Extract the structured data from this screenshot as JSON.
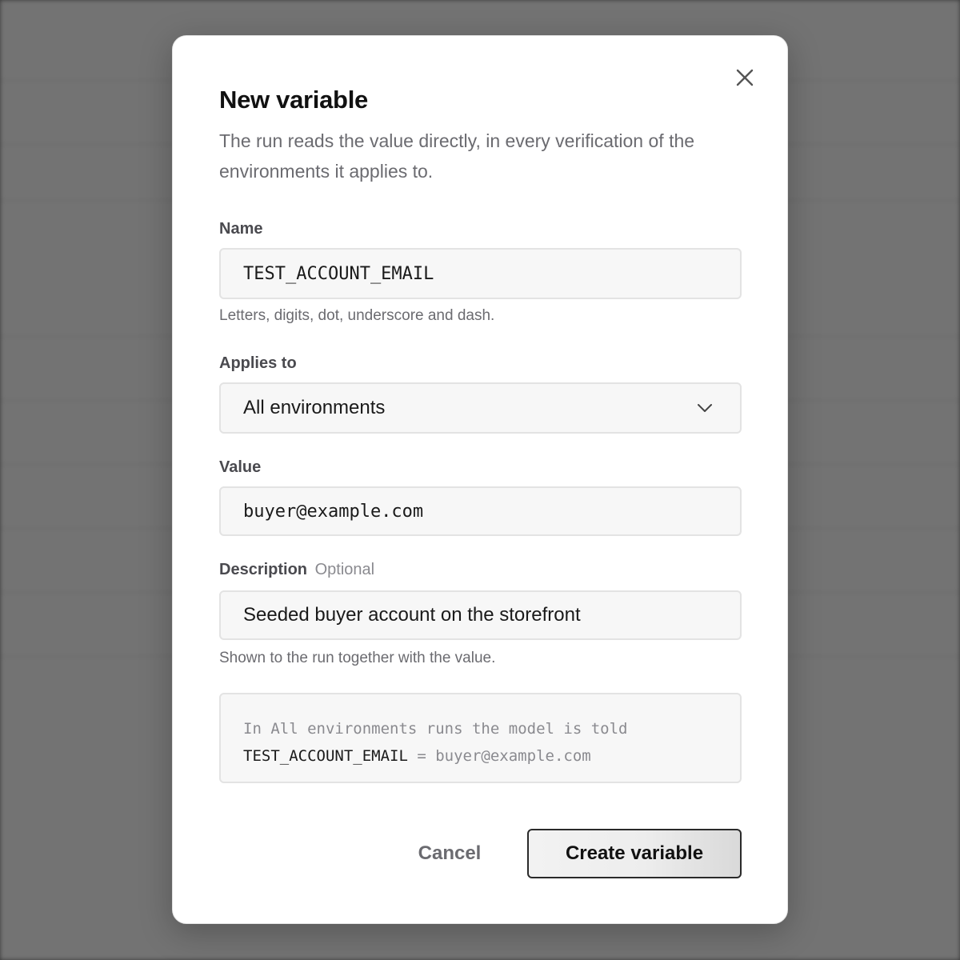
{
  "modal": {
    "title": "New variable",
    "description": "The run reads the value directly, in every verification of the environments it applies to.",
    "close_icon": "close-icon"
  },
  "form": {
    "name": {
      "label": "Name",
      "value": "TEST_ACCOUNT_EMAIL",
      "hint": "Letters, digits, dot, underscore and dash."
    },
    "applies_to": {
      "label": "Applies to",
      "selected": "All environments",
      "icon": "chevron-down-icon"
    },
    "value": {
      "label": "Value",
      "value": "buyer@example.com"
    },
    "description": {
      "label": "Description",
      "optional_tag": "Optional",
      "value": "Seeded buyer account on the storefront",
      "hint": "Shown to the run together with the value."
    }
  },
  "preview": {
    "prefix": "In ",
    "environment": "All environments",
    "suffix": " runs the model is told",
    "var_name": "TEST_ACCOUNT_EMAIL",
    "separator": " = ",
    "var_value": "buyer@example.com"
  },
  "actions": {
    "cancel_label": "Cancel",
    "create_label": "Create variable"
  },
  "colors": {
    "overlay": "#000000",
    "modal_bg": "#ffffff",
    "muted_text": "#6b6b70",
    "input_bg": "#f7f7f7",
    "input_border": "#e3e3e3"
  }
}
